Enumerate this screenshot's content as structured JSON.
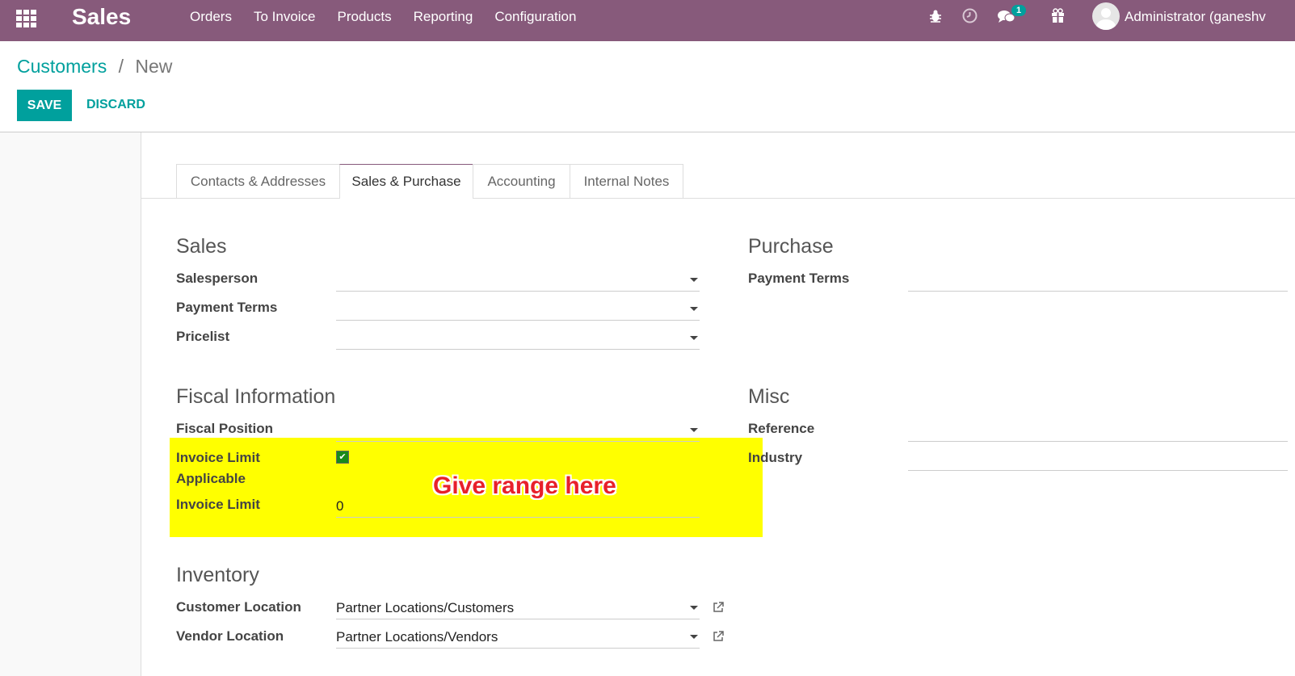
{
  "topbar": {
    "brand": "Sales",
    "menu": [
      "Orders",
      "To Invoice",
      "Products",
      "Reporting",
      "Configuration"
    ],
    "chat_badge": "1",
    "user": "Administrator (ganeshv"
  },
  "breadcrumb": {
    "parent": "Customers",
    "separator": "/",
    "current": "New"
  },
  "buttons": {
    "save": "SAVE",
    "discard": "DISCARD"
  },
  "tabs": [
    "Contacts & Addresses",
    "Sales & Purchase",
    "Accounting",
    "Internal Notes"
  ],
  "sales": {
    "title": "Sales",
    "salesperson_label": "Salesperson",
    "salesperson_value": "",
    "payment_terms_label": "Payment Terms",
    "payment_terms_value": "",
    "pricelist_label": "Pricelist",
    "pricelist_value": ""
  },
  "purchase": {
    "title": "Purchase",
    "payment_terms_label": "Payment Terms",
    "payment_terms_value": ""
  },
  "fiscal": {
    "title": "Fiscal Information",
    "fiscal_position_label": "Fiscal Position",
    "fiscal_position_value": "",
    "invoice_limit_applicable_label_1": "Invoice Limit",
    "invoice_limit_applicable_label_2": "Applicable",
    "invoice_limit_applicable_checked": true,
    "invoice_limit_label": "Invoice Limit",
    "invoice_limit_value": "0"
  },
  "misc": {
    "title": "Misc",
    "reference_label": "Reference",
    "reference_value": "",
    "industry_label": "Industry",
    "industry_value": ""
  },
  "inventory": {
    "title": "Inventory",
    "customer_location_label": "Customer Location",
    "customer_location_value": "Partner Locations/Customers",
    "vendor_location_label": "Vendor Location",
    "vendor_location_value": "Partner Locations/Vendors"
  },
  "annotation": "Give range here",
  "colors": {
    "topbar": "#875a7b",
    "accent": "#00a09d",
    "highlight": "#ffff00",
    "annotation": "#e8202a"
  }
}
